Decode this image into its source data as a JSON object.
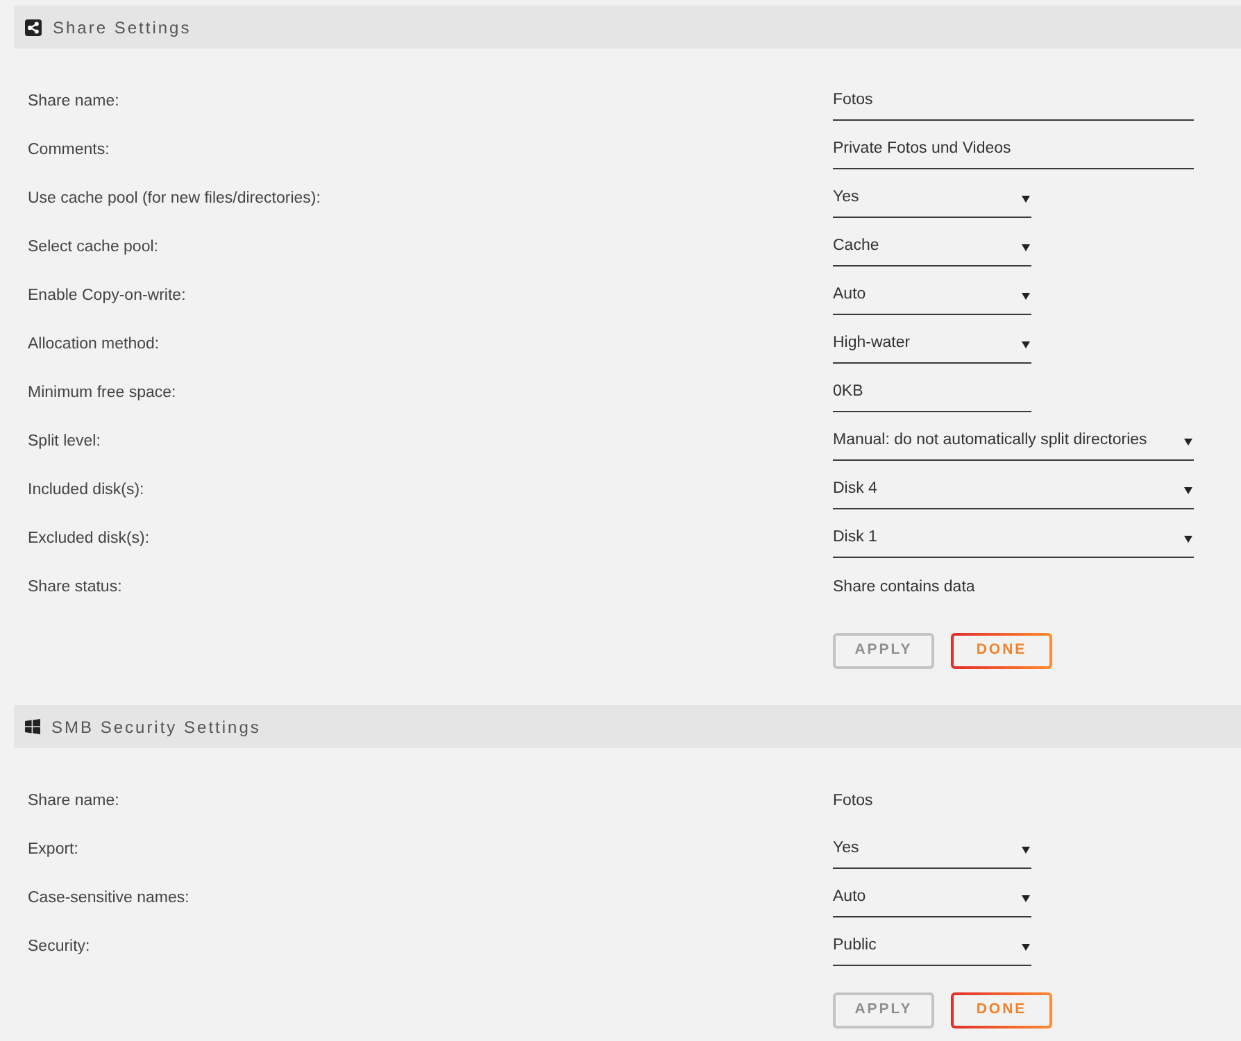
{
  "sections": [
    {
      "kind": "share",
      "title": "Share Settings",
      "rows": [
        {
          "label": "Share name:",
          "kind": "text-wide",
          "value": "Fotos"
        },
        {
          "label": "Comments:",
          "kind": "text-wide",
          "value": "Private Fotos und Videos"
        },
        {
          "label": "Use cache pool (for new files/directories):",
          "kind": "select",
          "value": "Yes"
        },
        {
          "label": "Select cache pool:",
          "kind": "select",
          "value": "Cache"
        },
        {
          "label": "Enable Copy-on-write:",
          "kind": "select",
          "value": "Auto"
        },
        {
          "label": "Allocation method:",
          "kind": "select",
          "value": "High-water"
        },
        {
          "label": "Minimum free space:",
          "kind": "text",
          "value": "0KB"
        },
        {
          "label": "Split level:",
          "kind": "select-wide",
          "value": "Manual: do not automatically split directories"
        },
        {
          "label": "Included disk(s):",
          "kind": "select-wide",
          "value": "Disk 4"
        },
        {
          "label": "Excluded disk(s):",
          "kind": "select-wide",
          "value": "Disk 1"
        },
        {
          "label": "Share status:",
          "kind": "static",
          "value": "Share contains data"
        }
      ],
      "buttons": [
        {
          "label": "APPLY",
          "disabled": true
        },
        {
          "label": "DONE",
          "disabled": false
        }
      ]
    },
    {
      "kind": "smb",
      "title": "SMB Security Settings",
      "rows": [
        {
          "label": "Share name:",
          "kind": "static",
          "value": "Fotos"
        },
        {
          "label": "Export:",
          "kind": "select",
          "value": "Yes"
        },
        {
          "label": "Case-sensitive names:",
          "kind": "select",
          "value": "Auto"
        },
        {
          "label": "Security:",
          "kind": "select",
          "value": "Public"
        }
      ],
      "buttons": [
        {
          "label": "APPLY",
          "disabled": true
        },
        {
          "label": "DONE",
          "disabled": false
        }
      ]
    }
  ]
}
